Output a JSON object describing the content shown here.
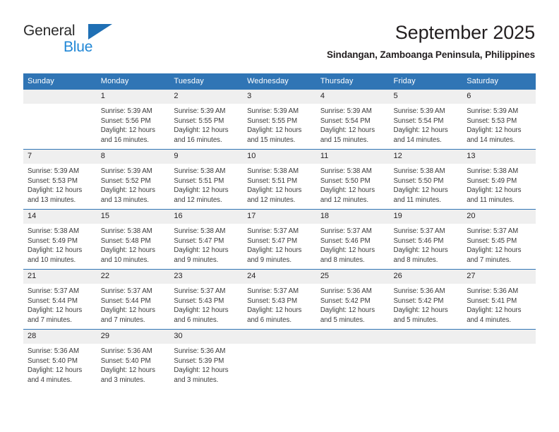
{
  "brand": {
    "name_part1": "General",
    "name_part2": "Blue",
    "triangle_color": "#1f6fb4",
    "part1_color": "#2b2b2b",
    "part2_color": "#2087d6"
  },
  "header": {
    "title": "September 2025",
    "subtitle": "Sindangan, Zamboanga Peninsula, Philippines"
  },
  "theme": {
    "header_blue": "#3075b5",
    "daynum_bg": "#efefef",
    "text": "#231f20"
  },
  "calendar": {
    "weekday_headers": [
      "Sunday",
      "Monday",
      "Tuesday",
      "Wednesday",
      "Thursday",
      "Friday",
      "Saturday"
    ],
    "labels": {
      "sunrise_prefix": "Sunrise:",
      "sunset_prefix": "Sunset:",
      "daylight_prefix": "Daylight:"
    },
    "weeks": [
      [
        {
          "day": "",
          "empty": true
        },
        {
          "day": "1",
          "sunrise": "Sunrise: 5:39 AM",
          "sunset": "Sunset: 5:56 PM",
          "daylight": "Daylight: 12 hours and 16 minutes."
        },
        {
          "day": "2",
          "sunrise": "Sunrise: 5:39 AM",
          "sunset": "Sunset: 5:55 PM",
          "daylight": "Daylight: 12 hours and 16 minutes."
        },
        {
          "day": "3",
          "sunrise": "Sunrise: 5:39 AM",
          "sunset": "Sunset: 5:55 PM",
          "daylight": "Daylight: 12 hours and 15 minutes."
        },
        {
          "day": "4",
          "sunrise": "Sunrise: 5:39 AM",
          "sunset": "Sunset: 5:54 PM",
          "daylight": "Daylight: 12 hours and 15 minutes."
        },
        {
          "day": "5",
          "sunrise": "Sunrise: 5:39 AM",
          "sunset": "Sunset: 5:54 PM",
          "daylight": "Daylight: 12 hours and 14 minutes."
        },
        {
          "day": "6",
          "sunrise": "Sunrise: 5:39 AM",
          "sunset": "Sunset: 5:53 PM",
          "daylight": "Daylight: 12 hours and 14 minutes."
        }
      ],
      [
        {
          "day": "7",
          "sunrise": "Sunrise: 5:39 AM",
          "sunset": "Sunset: 5:53 PM",
          "daylight": "Daylight: 12 hours and 13 minutes."
        },
        {
          "day": "8",
          "sunrise": "Sunrise: 5:39 AM",
          "sunset": "Sunset: 5:52 PM",
          "daylight": "Daylight: 12 hours and 13 minutes."
        },
        {
          "day": "9",
          "sunrise": "Sunrise: 5:38 AM",
          "sunset": "Sunset: 5:51 PM",
          "daylight": "Daylight: 12 hours and 12 minutes."
        },
        {
          "day": "10",
          "sunrise": "Sunrise: 5:38 AM",
          "sunset": "Sunset: 5:51 PM",
          "daylight": "Daylight: 12 hours and 12 minutes."
        },
        {
          "day": "11",
          "sunrise": "Sunrise: 5:38 AM",
          "sunset": "Sunset: 5:50 PM",
          "daylight": "Daylight: 12 hours and 12 minutes."
        },
        {
          "day": "12",
          "sunrise": "Sunrise: 5:38 AM",
          "sunset": "Sunset: 5:50 PM",
          "daylight": "Daylight: 12 hours and 11 minutes."
        },
        {
          "day": "13",
          "sunrise": "Sunrise: 5:38 AM",
          "sunset": "Sunset: 5:49 PM",
          "daylight": "Daylight: 12 hours and 11 minutes."
        }
      ],
      [
        {
          "day": "14",
          "sunrise": "Sunrise: 5:38 AM",
          "sunset": "Sunset: 5:49 PM",
          "daylight": "Daylight: 12 hours and 10 minutes."
        },
        {
          "day": "15",
          "sunrise": "Sunrise: 5:38 AM",
          "sunset": "Sunset: 5:48 PM",
          "daylight": "Daylight: 12 hours and 10 minutes."
        },
        {
          "day": "16",
          "sunrise": "Sunrise: 5:38 AM",
          "sunset": "Sunset: 5:47 PM",
          "daylight": "Daylight: 12 hours and 9 minutes."
        },
        {
          "day": "17",
          "sunrise": "Sunrise: 5:37 AM",
          "sunset": "Sunset: 5:47 PM",
          "daylight": "Daylight: 12 hours and 9 minutes."
        },
        {
          "day": "18",
          "sunrise": "Sunrise: 5:37 AM",
          "sunset": "Sunset: 5:46 PM",
          "daylight": "Daylight: 12 hours and 8 minutes."
        },
        {
          "day": "19",
          "sunrise": "Sunrise: 5:37 AM",
          "sunset": "Sunset: 5:46 PM",
          "daylight": "Daylight: 12 hours and 8 minutes."
        },
        {
          "day": "20",
          "sunrise": "Sunrise: 5:37 AM",
          "sunset": "Sunset: 5:45 PM",
          "daylight": "Daylight: 12 hours and 7 minutes."
        }
      ],
      [
        {
          "day": "21",
          "sunrise": "Sunrise: 5:37 AM",
          "sunset": "Sunset: 5:44 PM",
          "daylight": "Daylight: 12 hours and 7 minutes."
        },
        {
          "day": "22",
          "sunrise": "Sunrise: 5:37 AM",
          "sunset": "Sunset: 5:44 PM",
          "daylight": "Daylight: 12 hours and 7 minutes."
        },
        {
          "day": "23",
          "sunrise": "Sunrise: 5:37 AM",
          "sunset": "Sunset: 5:43 PM",
          "daylight": "Daylight: 12 hours and 6 minutes."
        },
        {
          "day": "24",
          "sunrise": "Sunrise: 5:37 AM",
          "sunset": "Sunset: 5:43 PM",
          "daylight": "Daylight: 12 hours and 6 minutes."
        },
        {
          "day": "25",
          "sunrise": "Sunrise: 5:36 AM",
          "sunset": "Sunset: 5:42 PM",
          "daylight": "Daylight: 12 hours and 5 minutes."
        },
        {
          "day": "26",
          "sunrise": "Sunrise: 5:36 AM",
          "sunset": "Sunset: 5:42 PM",
          "daylight": "Daylight: 12 hours and 5 minutes."
        },
        {
          "day": "27",
          "sunrise": "Sunrise: 5:36 AM",
          "sunset": "Sunset: 5:41 PM",
          "daylight": "Daylight: 12 hours and 4 minutes."
        }
      ],
      [
        {
          "day": "28",
          "sunrise": "Sunrise: 5:36 AM",
          "sunset": "Sunset: 5:40 PM",
          "daylight": "Daylight: 12 hours and 4 minutes."
        },
        {
          "day": "29",
          "sunrise": "Sunrise: 5:36 AM",
          "sunset": "Sunset: 5:40 PM",
          "daylight": "Daylight: 12 hours and 3 minutes."
        },
        {
          "day": "30",
          "sunrise": "Sunrise: 5:36 AM",
          "sunset": "Sunset: 5:39 PM",
          "daylight": "Daylight: 12 hours and 3 minutes."
        },
        {
          "day": "",
          "empty": true
        },
        {
          "day": "",
          "empty": true
        },
        {
          "day": "",
          "empty": true
        },
        {
          "day": "",
          "empty": true
        }
      ]
    ]
  }
}
